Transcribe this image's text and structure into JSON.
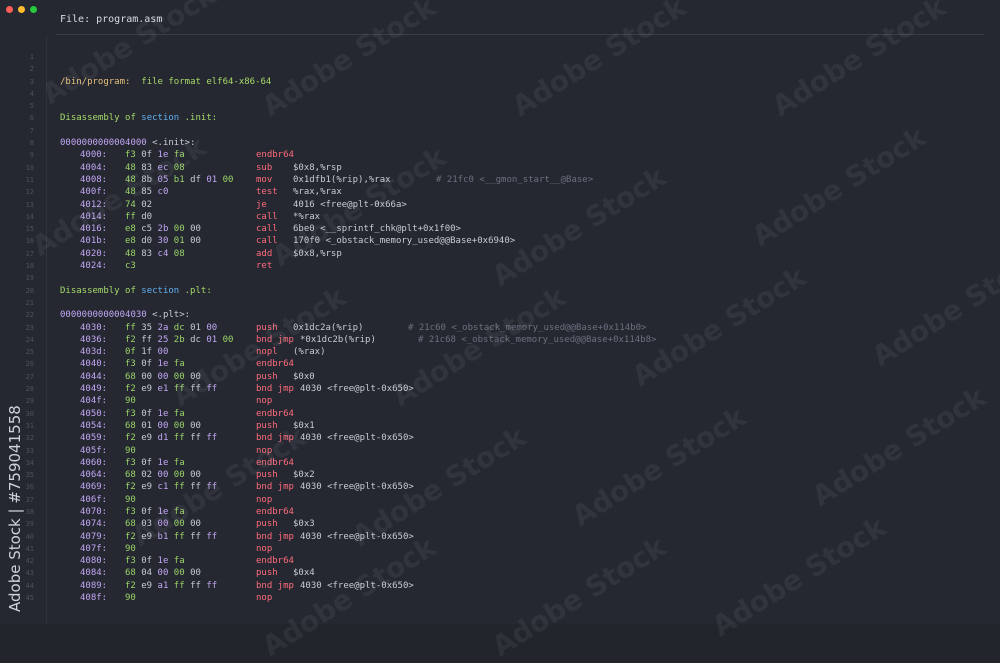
{
  "window": {
    "title": "File: program.asm"
  },
  "watermark": {
    "text": "Adobe Stock",
    "side_text": "Adobe Stock | #759041558"
  },
  "lines": [
    {
      "n": "1",
      "kind": "blank"
    },
    {
      "n": "2",
      "kind": "blank"
    },
    {
      "n": "3",
      "kind": "fileformat",
      "path": "/bin/program:",
      "fmt": "file format elf64-x86-64"
    },
    {
      "n": "4",
      "kind": "blank"
    },
    {
      "n": "5",
      "kind": "blank"
    },
    {
      "n": "6",
      "kind": "section",
      "a": "Disassembly of",
      "b": "section",
      "c": ".init:"
    },
    {
      "n": "7",
      "kind": "blank"
    },
    {
      "n": "8",
      "kind": "label",
      "a": "0000000000004000",
      "b": "<.init>:"
    },
    {
      "n": "9",
      "kind": "ins",
      "addr": "4000:",
      "bytes": "f3 0f 1e fa",
      "mn": "endbr64",
      "op": ""
    },
    {
      "n": "10",
      "kind": "ins",
      "addr": "4004:",
      "bytes": "48 83 ec 08",
      "mn": "sub",
      "op": "$0x8,%rsp"
    },
    {
      "n": "11",
      "kind": "ins",
      "addr": "4008:",
      "bytes": "48 8b 05 b1 df 01 00",
      "mn": "mov",
      "op": "0x1dfb1(%rip),%rax",
      "comment": "# 21fc0 <__gmon_start__@Base>"
    },
    {
      "n": "12",
      "kind": "ins",
      "addr": "400f:",
      "bytes": "48 85 c0",
      "mn": "test",
      "op": "%rax,%rax"
    },
    {
      "n": "13",
      "kind": "ins",
      "addr": "4012:",
      "bytes": "74 02",
      "mn": "je",
      "op": "4016 <free@plt-0x66a>"
    },
    {
      "n": "14",
      "kind": "ins",
      "addr": "4014:",
      "bytes": "ff d0",
      "mn": "call",
      "op": "*%rax"
    },
    {
      "n": "15",
      "kind": "ins",
      "addr": "4016:",
      "bytes": "e8 c5 2b 00 00",
      "mn": "call",
      "op": "6be0 <__sprintf_chk@plt+0x1f00>"
    },
    {
      "n": "16",
      "kind": "ins",
      "addr": "401b:",
      "bytes": "e8 d0 30 01 00",
      "mn": "call",
      "op": "170f0 <_obstack_memory_used@@Base+0x6940>"
    },
    {
      "n": "17",
      "kind": "ins",
      "addr": "4020:",
      "bytes": "48 83 c4 08",
      "mn": "add",
      "op": "$0x8,%rsp"
    },
    {
      "n": "18",
      "kind": "ins",
      "addr": "4024:",
      "bytes": "c3",
      "mn": "ret",
      "op": ""
    },
    {
      "n": "19",
      "kind": "blank"
    },
    {
      "n": "20",
      "kind": "section",
      "a": "Disassembly of",
      "b": "section",
      "c": ".plt:"
    },
    {
      "n": "21",
      "kind": "blank"
    },
    {
      "n": "22",
      "kind": "label",
      "a": "0000000000004030",
      "b": "<.plt>:"
    },
    {
      "n": "23",
      "kind": "ins",
      "addr": "4030:",
      "bytes": "ff 35 2a dc 01 00",
      "mn": "push",
      "op": "0x1dc2a(%rip)",
      "comment": "# 21c60 <_obstack_memory_used@@Base+0x114b0>"
    },
    {
      "n": "24",
      "kind": "ins",
      "addr": "4036:",
      "bytes": "f2 ff 25 2b dc 01 00",
      "mn": "bnd jmp",
      "op": "*0x1dc2b(%rip)",
      "comment": "# 21c68 <_obstack_memory_used@@Base+0x114b8>",
      "wide": true
    },
    {
      "n": "25",
      "kind": "ins",
      "addr": "403d:",
      "bytes": "0f 1f 00",
      "mn": "nopl",
      "op": "(%rax)"
    },
    {
      "n": "26",
      "kind": "ins",
      "addr": "4040:",
      "bytes": "f3 0f 1e fa",
      "mn": "endbr64",
      "op": ""
    },
    {
      "n": "27",
      "kind": "ins",
      "addr": "4044:",
      "bytes": "68 00 00 00 00",
      "mn": "push",
      "op": "$0x0"
    },
    {
      "n": "28",
      "kind": "ins",
      "addr": "4049:",
      "bytes": "f2 e9 e1 ff ff ff",
      "mn": "bnd jmp",
      "op": "4030 <free@plt-0x650>",
      "wide": true
    },
    {
      "n": "29",
      "kind": "ins",
      "addr": "404f:",
      "bytes": "90",
      "mn": "nop",
      "op": ""
    },
    {
      "n": "30",
      "kind": "ins",
      "addr": "4050:",
      "bytes": "f3 0f 1e fa",
      "mn": "endbr64",
      "op": ""
    },
    {
      "n": "31",
      "kind": "ins",
      "addr": "4054:",
      "bytes": "68 01 00 00 00",
      "mn": "push",
      "op": "$0x1"
    },
    {
      "n": "32",
      "kind": "ins",
      "addr": "4059:",
      "bytes": "f2 e9 d1 ff ff ff",
      "mn": "bnd jmp",
      "op": "4030 <free@plt-0x650>",
      "wide": true
    },
    {
      "n": "33",
      "kind": "ins",
      "addr": "405f:",
      "bytes": "90",
      "mn": "nop",
      "op": ""
    },
    {
      "n": "34",
      "kind": "ins",
      "addr": "4060:",
      "bytes": "f3 0f 1e fa",
      "mn": "endbr64",
      "op": ""
    },
    {
      "n": "35",
      "kind": "ins",
      "addr": "4064:",
      "bytes": "68 02 00 00 00",
      "mn": "push",
      "op": "$0x2"
    },
    {
      "n": "36",
      "kind": "ins",
      "addr": "4069:",
      "bytes": "f2 e9 c1 ff ff ff",
      "mn": "bnd jmp",
      "op": "4030 <free@plt-0x650>",
      "wide": true
    },
    {
      "n": "37",
      "kind": "ins",
      "addr": "406f:",
      "bytes": "90",
      "mn": "nop",
      "op": ""
    },
    {
      "n": "38",
      "kind": "ins",
      "addr": "4070:",
      "bytes": "f3 0f 1e fa",
      "mn": "endbr64",
      "op": ""
    },
    {
      "n": "39",
      "kind": "ins",
      "addr": "4074:",
      "bytes": "68 03 00 00 00",
      "mn": "push",
      "op": "$0x3"
    },
    {
      "n": "40",
      "kind": "ins",
      "addr": "4079:",
      "bytes": "f2 e9 b1 ff ff ff",
      "mn": "bnd jmp",
      "op": "4030 <free@plt-0x650>",
      "wide": true
    },
    {
      "n": "41",
      "kind": "ins",
      "addr": "407f:",
      "bytes": "90",
      "mn": "nop",
      "op": ""
    },
    {
      "n": "42",
      "kind": "ins",
      "addr": "4080:",
      "bytes": "f3 0f 1e fa",
      "mn": "endbr64",
      "op": ""
    },
    {
      "n": "43",
      "kind": "ins",
      "addr": "4084:",
      "bytes": "68 04 00 00 00",
      "mn": "push",
      "op": "$0x4"
    },
    {
      "n": "44",
      "kind": "ins",
      "addr": "4089:",
      "bytes": "f2 e9 a1 ff ff ff",
      "mn": "bnd jmp",
      "op": "4030 <free@plt-0x650>",
      "wide": true
    },
    {
      "n": "45",
      "kind": "ins",
      "addr": "408f:",
      "bytes": "90",
      "mn": "nop",
      "op": ""
    }
  ]
}
